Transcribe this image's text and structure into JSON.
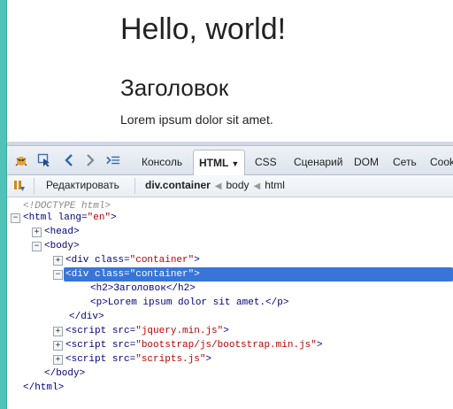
{
  "page": {
    "h1": "Hello, world!",
    "h2": "Заголовок",
    "p": "Lorem ipsum dolor sit amet."
  },
  "devtools": {
    "tabs": [
      {
        "label": "Консоль"
      },
      {
        "label": "HTML",
        "active": true
      },
      {
        "label": "CSS"
      },
      {
        "label": "Сценарий"
      },
      {
        "label": "DOM"
      },
      {
        "label": "Сеть"
      },
      {
        "label": "Cook"
      }
    ],
    "toolbar": {
      "edit_label": "Редактировать",
      "breadcrumb": [
        "div.container",
        "body",
        "html"
      ]
    },
    "tree": {
      "doctype": "<!DOCTYPE html>",
      "html_open": "<html",
      "html_attr": "lang=",
      "html_val": "\"en\"",
      "html_close_br": ">",
      "head": "<head>",
      "body": "<body>",
      "div1_open": "<div",
      "div_attr": "class=",
      "div_val": "\"container\"",
      "div_close_br": ">",
      "h2_line": "<h2>Заголовок</h2>",
      "p_line": "<p>Lorem ipsum dolor sit amet.</p>",
      "div_end": "</div>",
      "script_open": "<script",
      "script_attr": "src=",
      "script1_val": "\"jquery.min.js\"",
      "script2_val": "\"bootstrap/js/bootstrap.min.js\"",
      "script3_val": "\"scripts.js\"",
      "body_end": "</body>",
      "html_end": "</html>"
    }
  }
}
